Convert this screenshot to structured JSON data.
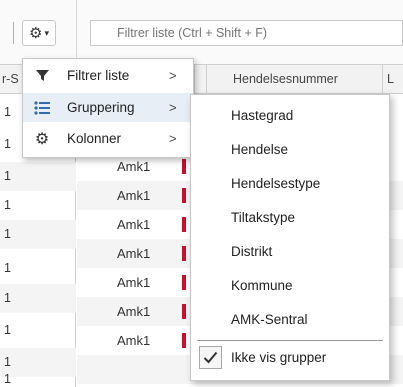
{
  "toolbar": {
    "settings_icon": "gear-icon",
    "dropdown_icon": "chevron-down-icon",
    "filter_placeholder": "Filtrer liste (Ctrl + Shift + F)"
  },
  "grid": {
    "header": {
      "left": "r-S",
      "hendelsesnummer": "Hendelsesnummer",
      "right": "L"
    },
    "left_values": [
      "1",
      "1",
      "1",
      "1",
      "1",
      "1",
      "1",
      "1",
      "1",
      "1"
    ],
    "rows": [
      "Amk1",
      "Amk1",
      "Amk1",
      "Amk1",
      "Amk1",
      "Amk1",
      "Amk1"
    ],
    "flag_color": "#c8102e"
  },
  "menu": {
    "items": [
      {
        "label": "Filtrer liste",
        "icon": "funnel-icon"
      },
      {
        "label": "Gruppering",
        "icon": "list-icon"
      },
      {
        "label": "Kolonner",
        "icon": "gear-icon"
      }
    ],
    "submenu_arrow": ">"
  },
  "submenu": {
    "items": [
      "Hastegrad",
      "Hendelse",
      "Hendelsestype",
      "Tiltakstype",
      "Distrikt",
      "Kommune",
      "AMK-Sentral"
    ],
    "checkbox_label": "Ikke vis grupper",
    "checkbox_checked": true
  },
  "colors": {
    "accent": "#2f6db3",
    "menu_hover": "#e8eef6"
  }
}
